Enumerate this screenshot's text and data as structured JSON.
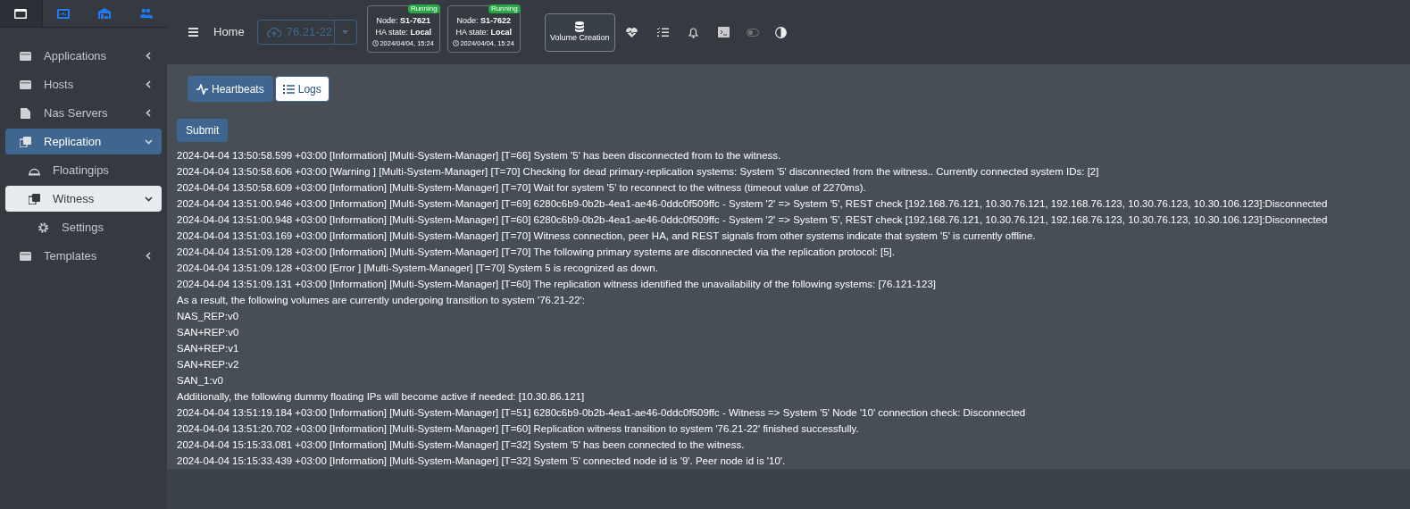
{
  "sidebar_tabs": [
    {
      "selected": true
    },
    {
      "selected": false
    },
    {
      "selected": false
    },
    {
      "selected": false
    }
  ],
  "sidebar": {
    "items": [
      {
        "label": "Applications",
        "expanded": false,
        "selected": false
      },
      {
        "label": "Hosts",
        "expanded": false,
        "selected": false
      },
      {
        "label": "Nas Servers",
        "expanded": false,
        "selected": false
      },
      {
        "label": "Replication",
        "expanded": true,
        "selected": true,
        "children": [
          {
            "label": "Floatingips",
            "selected": false
          },
          {
            "label": "Witness",
            "expanded": true,
            "selected": true,
            "children": [
              {
                "label": "Settings",
                "selected": false
              }
            ]
          }
        ]
      },
      {
        "label": "Templates",
        "expanded": false,
        "selected": false
      }
    ]
  },
  "topbar": {
    "home": "Home",
    "system_selector": "76.21-22",
    "nodes": [
      {
        "node_label": "Node:",
        "node": "S1-7621",
        "ha_label": "HA state:",
        "ha_state": "Local",
        "time": "2024/04/04, 15:24",
        "status": "Running"
      },
      {
        "node_label": "Node:",
        "node": "S1-7622",
        "ha_label": "HA state:",
        "ha_state": "Local",
        "time": "2024/04/04, 15:24",
        "status": "Running"
      }
    ],
    "volume_button": "Volume Creation"
  },
  "tabs": [
    {
      "label": "Heartbeats",
      "selected": false
    },
    {
      "label": "Logs",
      "selected": true
    }
  ],
  "submit": "Submit",
  "log_lines": [
    "2024-04-04 13:50:58.599 +03:00 [Information] [Multi-System-Manager] [T=66] System '5' has been disconnected from to the witness.",
    "2024-04-04 13:50:58.606 +03:00 [Warning ] [Multi-System-Manager] [T=70] Checking for dead primary-replication systems: System '5' disconnected from the witness.. Currently connected system IDs: [2]",
    "2024-04-04 13:50:58.609 +03:00 [Information] [Multi-System-Manager] [T=70] Wait for system '5' to reconnect to the witness (timeout value of 2270ms).",
    "2024-04-04 13:51:00.946 +03:00 [Information] [Multi-System-Manager] [T=69] 6280c6b9-0b2b-4ea1-ae46-0ddc0f509ffc - System '2' => System '5', REST check [192.168.76.121, 10.30.76.121, 192.168.76.123, 10.30.76.123, 10.30.106.123]:Disconnected",
    "2024-04-04 13:51:00.948 +03:00 [Information] [Multi-System-Manager] [T=60] 6280c6b9-0b2b-4ea1-ae46-0ddc0f509ffc - System '2' => System '5', REST check [192.168.76.121, 10.30.76.121, 192.168.76.123, 10.30.76.123, 10.30.106.123]:Disconnected",
    "2024-04-04 13:51:03.169 +03:00 [Information] [Multi-System-Manager] [T=70] Witness connection, peer HA, and REST signals from other systems indicate that system '5' is currently offline.",
    "2024-04-04 13:51:09.128 +03:00 [Information] [Multi-System-Manager] [T=70] The following primary systems are disconnected via the replication protocol: [5].",
    "2024-04-04 13:51:09.128 +03:00 [Error ] [Multi-System-Manager] [T=70] System 5 is recognized as down.",
    "2024-04-04 13:51:09.131 +03:00 [Information] [Multi-System-Manager] [T=60] The replication witness identified the unavailability of the following systems: [76.121-123]",
    "As a result, the following volumes are currently undergoing transition to system '76.21-22':",
    "NAS_REP:v0",
    "SAN+REP:v0",
    "SAN+REP:v1",
    "SAN+REP:v2",
    "SAN_1:v0",
    "Additionally, the following dummy floating IPs will become active if needed: [10.30.86.121]",
    "2024-04-04 13:51:19.184 +03:00 [Information] [Multi-System-Manager] [T=51] 6280c6b9-0b2b-4ea1-ae46-0ddc0f509ffc - Witness => System '5' Node '10' connection check: Disconnected",
    "2024-04-04 13:51:20.702 +03:00 [Information] [Multi-System-Manager] [T=60] Replication witness transition to system '76.21-22' finished successfully.",
    "2024-04-04 15:15:33.081 +03:00 [Information] [Multi-System-Manager] [T=32] System '5' has been connected to the witness.",
    "2024-04-04 15:15:33.439 +03:00 [Information] [Multi-System-Manager] [T=32] System '5' connected node id is '9'. Peer node id is '10'."
  ]
}
